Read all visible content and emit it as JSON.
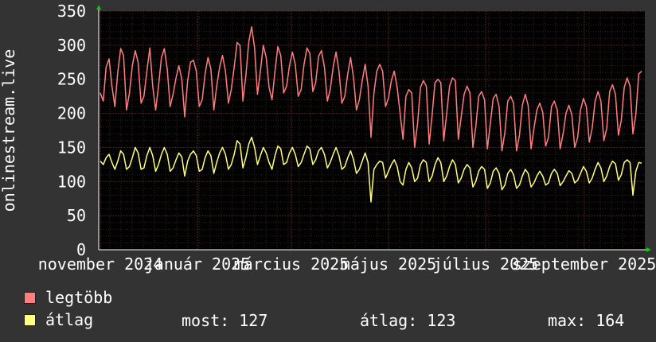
{
  "chart_data": {
    "type": "line",
    "ylabel": "onlinestream.live",
    "ylim": [
      0,
      350
    ],
    "yticks": [
      0,
      50,
      100,
      150,
      200,
      250,
      300,
      350
    ],
    "xlim": [
      "2024-10-31",
      "2025-10-09"
    ],
    "xticks": [
      {
        "label": "november 2024",
        "date": "2024-11-01"
      },
      {
        "label": "január 2025",
        "date": "2025-01-01"
      },
      {
        "label": "március 2025",
        "date": "2025-03-01"
      },
      {
        "label": "május 2025",
        "date": "2025-05-01"
      },
      {
        "label": "július 2025",
        "date": "2025-07-01"
      },
      {
        "label": "szeptember 2025",
        "date": "2025-09-01"
      }
    ],
    "grid": true,
    "colors": {
      "background": "#000000",
      "grid": "#5a2a2a",
      "axis": "#ffffff",
      "arrow": "#00cc00"
    },
    "series": [
      {
        "name": "legtöbb",
        "color": "#ff7f7f",
        "values": [
          230,
          218,
          268,
          280,
          240,
          210,
          260,
          295,
          285,
          205,
          230,
          270,
          292,
          275,
          215,
          225,
          262,
          296,
          240,
          205,
          240,
          282,
          295,
          265,
          210,
          228,
          252,
          270,
          250,
          195,
          248,
          275,
          278,
          262,
          210,
          220,
          258,
          282,
          265,
          205,
          240,
          268,
          285,
          262,
          215,
          235,
          268,
          304,
          300,
          218,
          255,
          305,
          327,
          296,
          228,
          262,
          300,
          282,
          238,
          220,
          262,
          298,
          285,
          230,
          240,
          270,
          290,
          272,
          225,
          235,
          272,
          296,
          288,
          232,
          245,
          284,
          292,
          268,
          218,
          235,
          268,
          290,
          262,
          215,
          225,
          258,
          282,
          252,
          205,
          220,
          248,
          272,
          240,
          165,
          230,
          262,
          272,
          262,
          210,
          222,
          248,
          262,
          238,
          200,
          162,
          225,
          235,
          230,
          150,
          185,
          238,
          248,
          240,
          155,
          198,
          245,
          250,
          245,
          160,
          200,
          240,
          252,
          248,
          162,
          195,
          228,
          240,
          230,
          150,
          180,
          225,
          232,
          220,
          148,
          185,
          222,
          228,
          210,
          145,
          172,
          218,
          225,
          215,
          145,
          168,
          212,
          228,
          212,
          148,
          178,
          205,
          215,
          202,
          152,
          165,
          210,
          218,
          205,
          148,
          170,
          200,
          212,
          198,
          150,
          165,
          205,
          222,
          210,
          158,
          178,
          218,
          232,
          218,
          160,
          178,
          232,
          242,
          228,
          168,
          190,
          238,
          252,
          240,
          170,
          198,
          258,
          262
        ],
        "stats": {
          "most": 127,
          "atlag": 123,
          "max": 164
        }
      },
      {
        "name": "átlag",
        "color": "#ffff80",
        "values": [
          130,
          125,
          135,
          140,
          128,
          118,
          130,
          145,
          140,
          118,
          122,
          135,
          150,
          142,
          118,
          120,
          138,
          150,
          138,
          115,
          125,
          140,
          150,
          140,
          115,
          120,
          132,
          142,
          136,
          108,
          130,
          140,
          145,
          138,
          115,
          118,
          135,
          145,
          138,
          112,
          128,
          142,
          150,
          140,
          118,
          125,
          140,
          160,
          155,
          120,
          135,
          155,
          165,
          150,
          125,
          138,
          150,
          142,
          128,
          118,
          138,
          152,
          148,
          125,
          128,
          142,
          150,
          140,
          122,
          128,
          140,
          152,
          148,
          125,
          132,
          145,
          150,
          140,
          120,
          128,
          140,
          150,
          138,
          118,
          122,
          135,
          145,
          132,
          112,
          118,
          130,
          142,
          128,
          70,
          118,
          125,
          130,
          128,
          105,
          115,
          125,
          132,
          122,
          100,
          95,
          118,
          128,
          120,
          100,
          105,
          125,
          132,
          128,
          100,
          108,
          125,
          135,
          128,
          100,
          108,
          122,
          132,
          125,
          98,
          105,
          118,
          125,
          120,
          92,
          100,
          115,
          122,
          118,
          90,
          98,
          115,
          120,
          112,
          88,
          95,
          112,
          118,
          110,
          90,
          95,
          108,
          118,
          112,
          92,
          98,
          108,
          115,
          108,
          95,
          98,
          112,
          118,
          112,
          94,
          100,
          108,
          116,
          112,
          98,
          102,
          112,
          122,
          115,
          98,
          105,
          118,
          128,
          120,
          100,
          108,
          122,
          130,
          126,
          102,
          110,
          128,
          132,
          128,
          80,
          115,
          128,
          127
        ],
        "stats": {
          "most": 127,
          "atlag": 123,
          "max": 164
        }
      }
    ]
  },
  "legend": {
    "max_label": "legtöbb",
    "avg_label": "átlag",
    "most_text": "most: 127",
    "atlag_text": "átlag: 123",
    "max_text": "max: 164"
  }
}
